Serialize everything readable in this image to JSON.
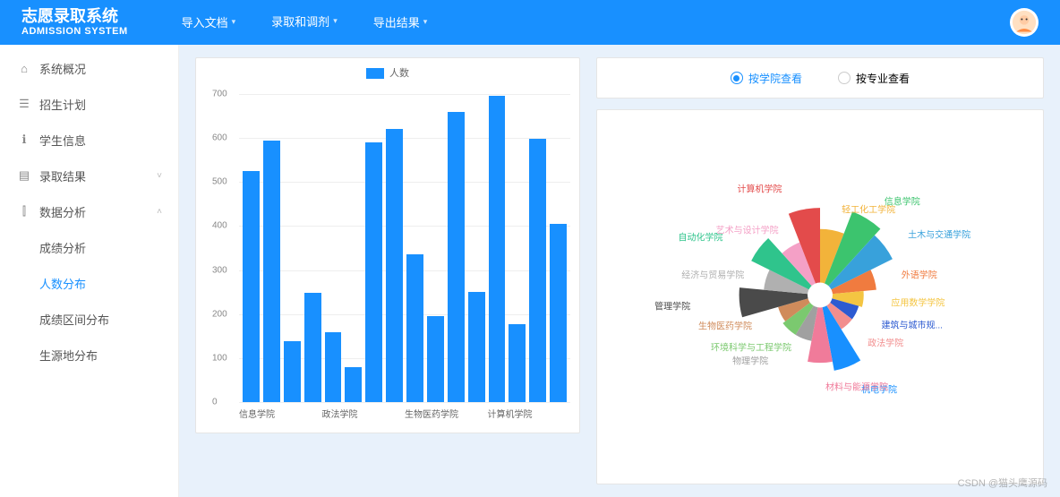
{
  "header": {
    "brand_title": "志愿录取系统",
    "brand_sub": "ADMISSION SYSTEM",
    "nav": [
      {
        "label": "导入文档"
      },
      {
        "label": "录取和调剂",
        "active": true
      },
      {
        "label": "导出结果"
      }
    ]
  },
  "sidebar": {
    "items": [
      {
        "label": "系统概况",
        "icon": "home"
      },
      {
        "label": "招生计划",
        "icon": "list"
      },
      {
        "label": "学生信息",
        "icon": "info"
      },
      {
        "label": "录取结果",
        "icon": "doc",
        "expandable": true,
        "open": false
      },
      {
        "label": "数据分析",
        "icon": "chart",
        "expandable": true,
        "open": true,
        "children": [
          {
            "label": "成绩分析"
          },
          {
            "label": "人数分布",
            "active": true
          },
          {
            "label": "成绩区间分布"
          },
          {
            "label": "生源地分布"
          }
        ]
      }
    ]
  },
  "filter": {
    "opt1": "按学院查看",
    "opt2": "按专业查看",
    "selected": 1
  },
  "chart_data": [
    {
      "type": "bar",
      "title": "",
      "legend": "人数",
      "ylabel": "",
      "ylim": [
        0,
        700
      ],
      "yticks": [
        0,
        100,
        200,
        300,
        400,
        500,
        600,
        700
      ],
      "categories": [
        "信息学院",
        "",
        "",
        "",
        "政法学院",
        "",
        "",
        "",
        "生物医药学院",
        "",
        "",
        "",
        "计算机学院",
        "",
        "",
        ""
      ],
      "values": [
        525,
        595,
        138,
        248,
        158,
        80,
        590,
        620,
        335,
        195,
        660,
        250,
        695,
        178,
        598,
        405
      ]
    },
    {
      "type": "pie",
      "series": [
        {
          "name": "轻工化工学院",
          "value": 28,
          "color": "#f2b33a"
        },
        {
          "name": "信息学院",
          "value": 62,
          "color": "#3cc46e"
        },
        {
          "name": "土木与交通学院",
          "value": 48,
          "color": "#38a1db"
        },
        {
          "name": "外语学院",
          "value": 18,
          "color": "#f07b3f"
        },
        {
          "name": "应用数学学院",
          "value": 8,
          "color": "#f4c542"
        },
        {
          "name": "建筑与城市规...",
          "value": 6,
          "color": "#2d5bd1"
        },
        {
          "name": "政法学院",
          "value": 6,
          "color": "#f28e8e"
        },
        {
          "name": "机电学院",
          "value": 42,
          "color": "#1890ff"
        },
        {
          "name": "材料与能源学院",
          "value": 30,
          "color": "#f07b9a"
        },
        {
          "name": "物理学院",
          "value": 10,
          "color": "#a0a0a0"
        },
        {
          "name": "环境科学与工程学院",
          "value": 10,
          "color": "#7bc96f"
        },
        {
          "name": "生物医药学院",
          "value": 8,
          "color": "#d08b5b"
        },
        {
          "name": "管理学院",
          "value": 48,
          "color": "#4a4a4a"
        },
        {
          "name": "经济与贸易学院",
          "value": 18,
          "color": "#b0b0b0"
        },
        {
          "name": "自动化学院",
          "value": 42,
          "color": "#2fc48c"
        },
        {
          "name": "艺术与设计学院",
          "value": 18,
          "color": "#f4a0c6"
        },
        {
          "name": "计算机学院",
          "value": 58,
          "color": "#e34b4b"
        }
      ]
    }
  ],
  "watermark": "CSDN @猫头鹰源码"
}
